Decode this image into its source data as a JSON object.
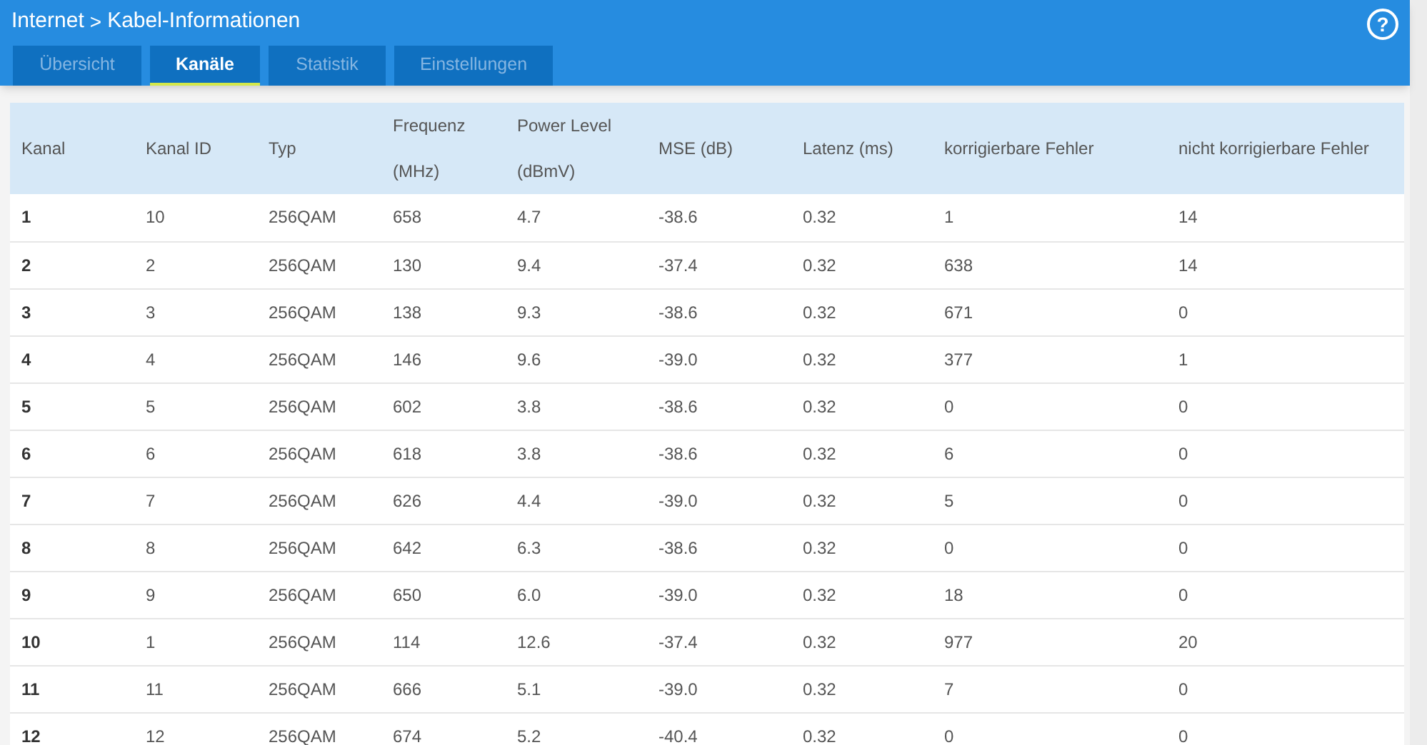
{
  "breadcrumb": {
    "section": "Internet",
    "separator": ">",
    "page": "Kabel-Informationen"
  },
  "help_icon": "?",
  "tabs": [
    {
      "label": "Übersicht",
      "selected": false
    },
    {
      "label": "Kanäle",
      "selected": true
    },
    {
      "label": "Statistik",
      "selected": false
    },
    {
      "label": "Einstellungen",
      "selected": false
    }
  ],
  "table": {
    "columns": [
      "Kanal",
      "Kanal ID",
      "Typ",
      "Frequenz (MHz)",
      "Power Level (dBmV)",
      "MSE (dB)",
      "Latenz (ms)",
      "korrigierbare Fehler",
      "nicht korrigierbare Fehler"
    ],
    "rows": [
      [
        "1",
        "10",
        "256QAM",
        "658",
        "4.7",
        "-38.6",
        "0.32",
        "1",
        "14"
      ],
      [
        "2",
        "2",
        "256QAM",
        "130",
        "9.4",
        "-37.4",
        "0.32",
        "638",
        "14"
      ],
      [
        "3",
        "3",
        "256QAM",
        "138",
        "9.3",
        "-38.6",
        "0.32",
        "671",
        "0"
      ],
      [
        "4",
        "4",
        "256QAM",
        "146",
        "9.6",
        "-39.0",
        "0.32",
        "377",
        "1"
      ],
      [
        "5",
        "5",
        "256QAM",
        "602",
        "3.8",
        "-38.6",
        "0.32",
        "0",
        "0"
      ],
      [
        "6",
        "6",
        "256QAM",
        "618",
        "3.8",
        "-38.6",
        "0.32",
        "6",
        "0"
      ],
      [
        "7",
        "7",
        "256QAM",
        "626",
        "4.4",
        "-39.0",
        "0.32",
        "5",
        "0"
      ],
      [
        "8",
        "8",
        "256QAM",
        "642",
        "6.3",
        "-38.6",
        "0.32",
        "0",
        "0"
      ],
      [
        "9",
        "9",
        "256QAM",
        "650",
        "6.0",
        "-39.0",
        "0.32",
        "18",
        "0"
      ],
      [
        "10",
        "1",
        "256QAM",
        "114",
        "12.6",
        "-37.4",
        "0.32",
        "977",
        "20"
      ],
      [
        "11",
        "11",
        "256QAM",
        "666",
        "5.1",
        "-39.0",
        "0.32",
        "7",
        "0"
      ],
      [
        "12",
        "12",
        "256QAM",
        "674",
        "5.2",
        "-40.4",
        "0.32",
        "0",
        "0"
      ]
    ]
  }
}
